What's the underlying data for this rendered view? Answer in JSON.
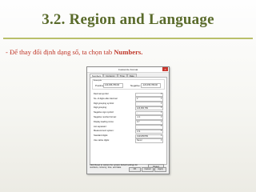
{
  "slide": {
    "title": "3.2. Region and Language",
    "bullet_prefix": "- Để thay đổi định dạng số, ta chọn tab ",
    "bullet_emphasis": "Numbers."
  },
  "dialog": {
    "title": "Customize Format",
    "close": "×",
    "tabs": [
      "Numbers",
      "Currency",
      "Time",
      "Date"
    ],
    "example_label": "Example",
    "positive_label": "Positive:",
    "positive_value": "123,456,789.00",
    "negative_label": "Negative:",
    "negative_value": "-123,456,789.00",
    "rows": [
      {
        "label": "Decimal symbol:",
        "value": "."
      },
      {
        "label": "No. of digits after decimal:",
        "value": "2"
      },
      {
        "label": "Digit grouping symbol:",
        "value": ","
      },
      {
        "label": "Digit grouping:",
        "value": "123,456,789"
      },
      {
        "label": "Negative sign symbol:",
        "value": "-"
      },
      {
        "label": "Negative number format:",
        "value": "-1.1"
      },
      {
        "label": "Display leading zeros:",
        "value": "0.7"
      },
      {
        "label": "List separator:",
        "value": ","
      },
      {
        "label": "Measurement system:",
        "value": "U.S."
      },
      {
        "label": "Standard digits:",
        "value": "0123456789"
      },
      {
        "label": "Use native digits:",
        "value": "Never"
      }
    ],
    "note": "Click Reset to restore the system default settings for numbers, currency, time, and date.",
    "reset": "Reset",
    "ok": "OK",
    "cancel": "Cancel",
    "apply": "Apply"
  }
}
